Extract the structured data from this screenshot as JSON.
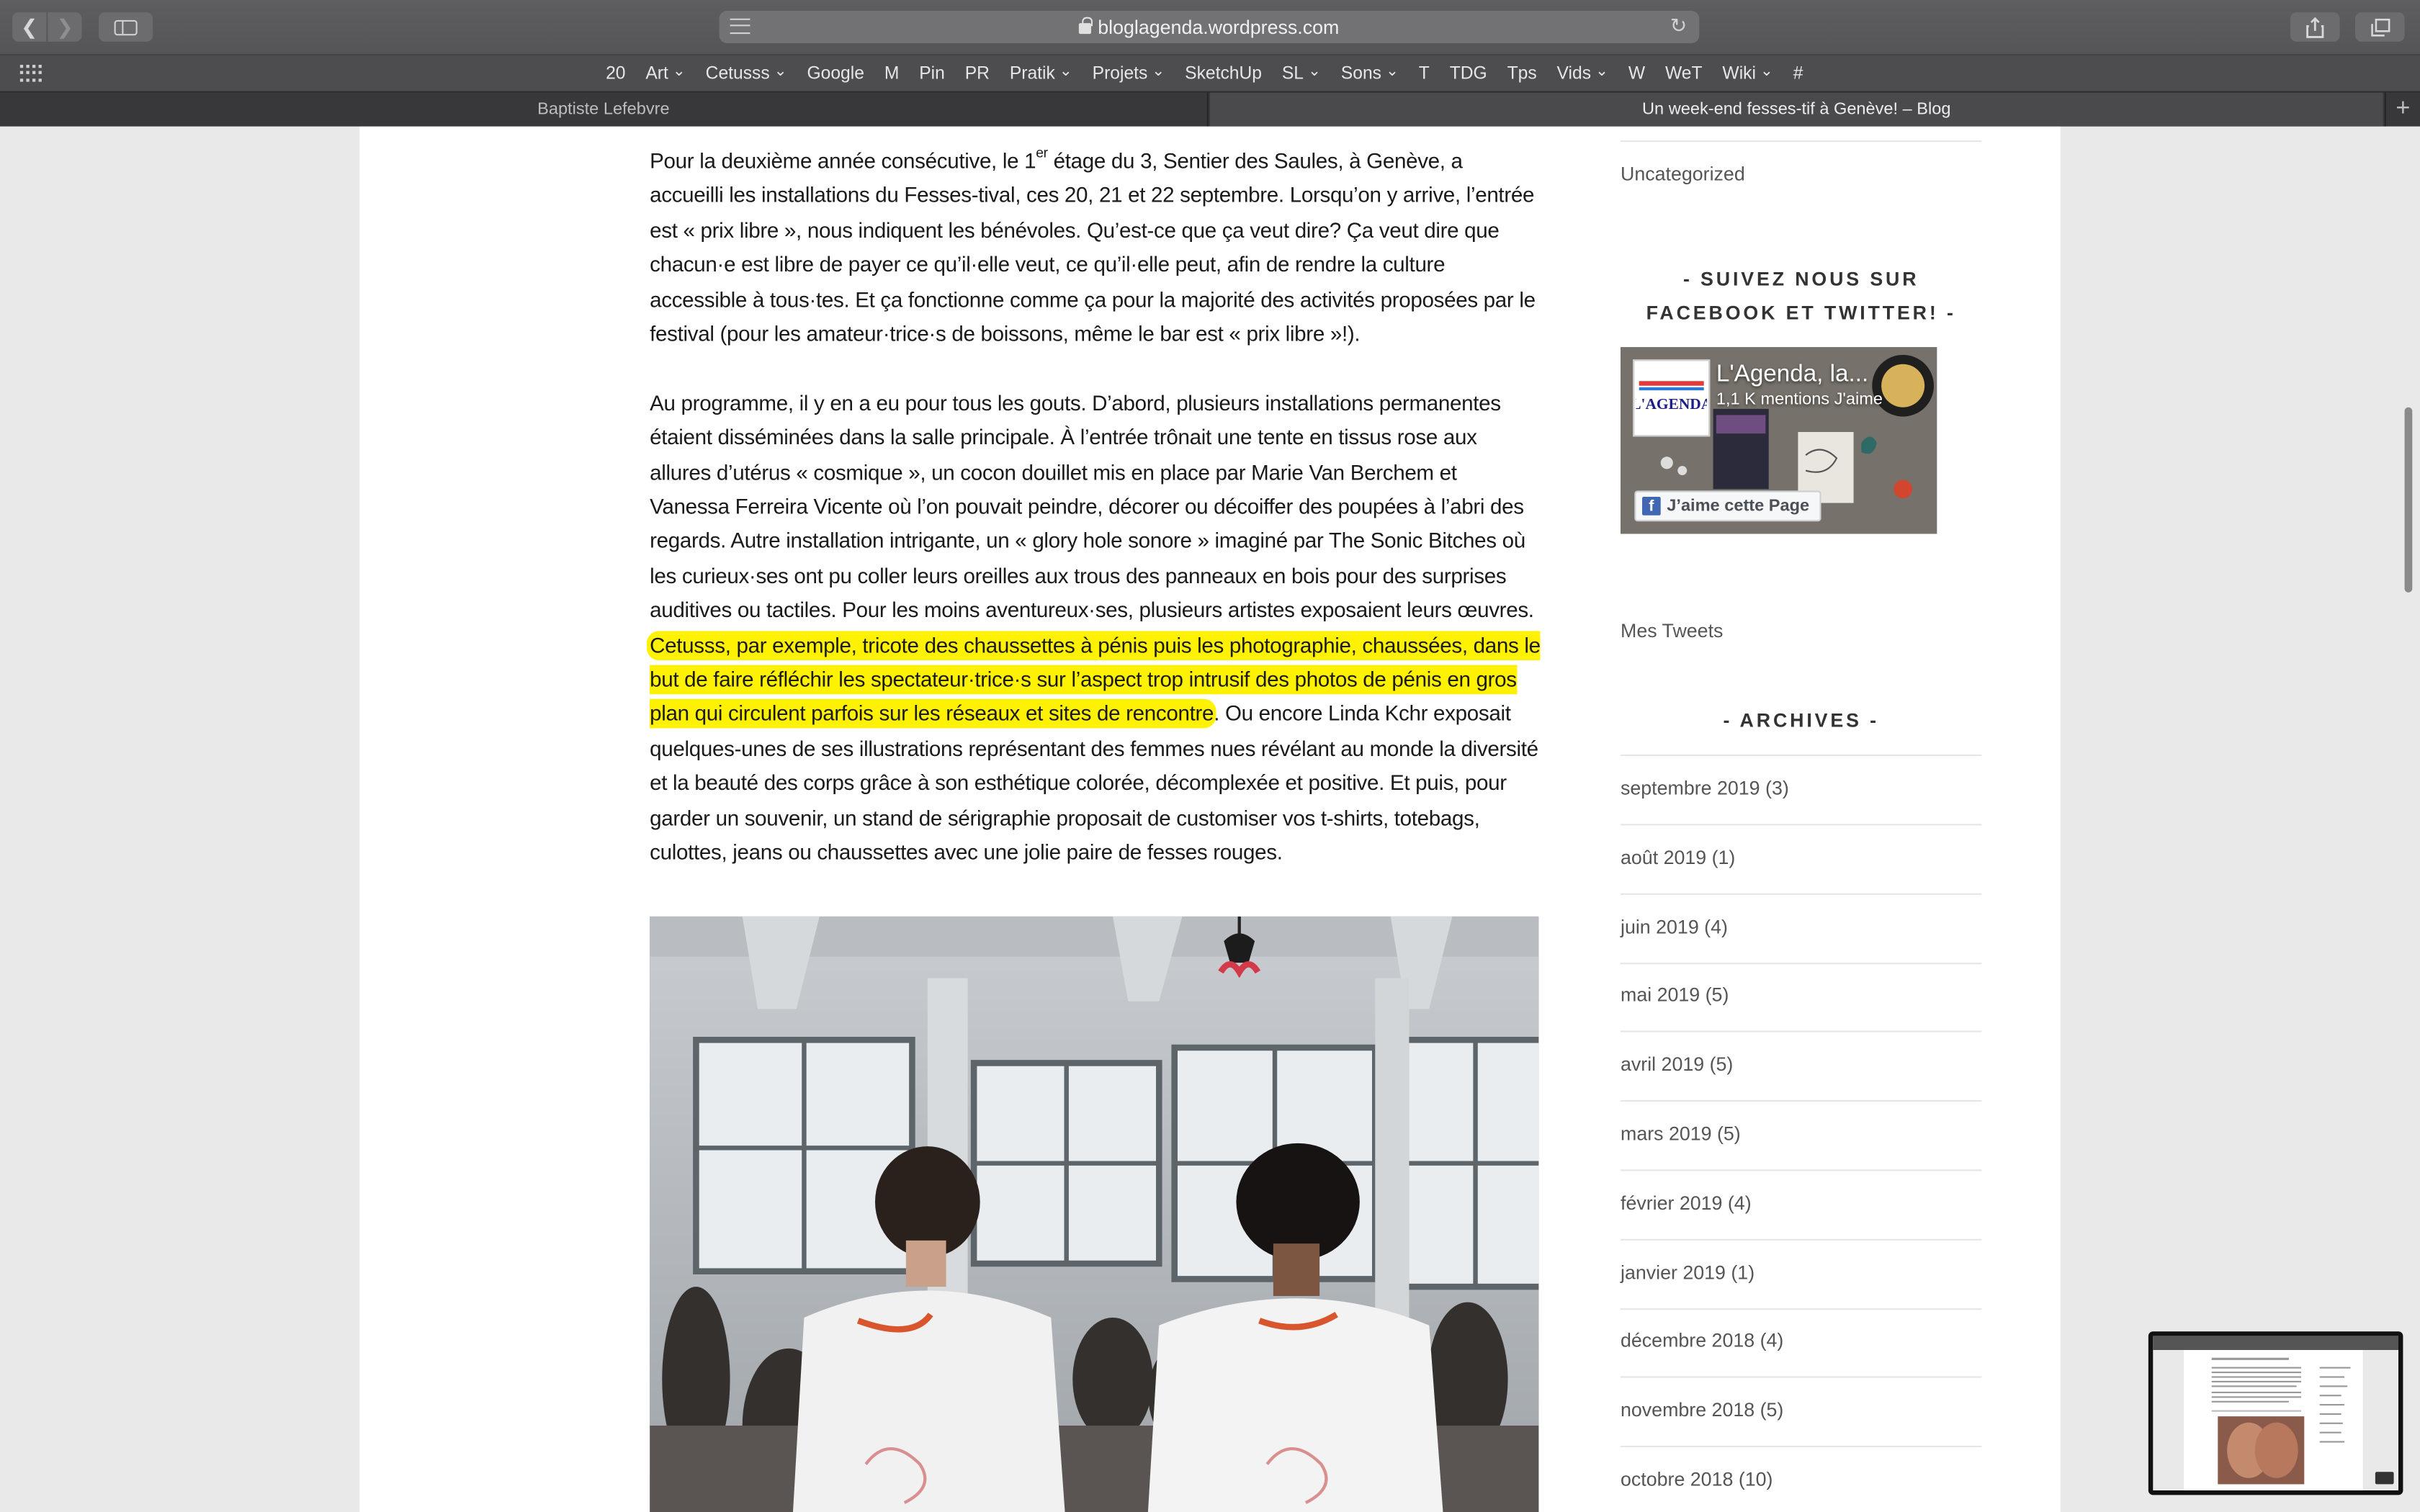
{
  "browser": {
    "url": "bloglagenda.wordpress.com",
    "favorites": [
      "20",
      "Art",
      "Cetusss",
      "Google",
      "M",
      "Pin",
      "PR",
      "Pratik",
      "Projets",
      "SketchUp",
      "SL",
      "Sons",
      "T",
      "TDG",
      "Tps",
      "Vids",
      "W",
      "WeT",
      "Wiki",
      "#"
    ],
    "favorites_with_menu": [
      "Art",
      "Cetusss",
      "Pratik",
      "Projets",
      "SL",
      "Sons",
      "Vids",
      "Wiki"
    ],
    "tabs": [
      {
        "title": "Baptiste Lefebvre",
        "active": false
      },
      {
        "title": "Un week-end fesses-tif à Genève! – Blog",
        "active": true
      }
    ],
    "icons": {
      "back": "chevron-left-icon",
      "forward": "chevron-right-icon",
      "sidebar": "sidebar-icon",
      "reader": "reader-icon",
      "lock": "lock-icon",
      "reload": "reload-icon",
      "share": "share-icon",
      "tabs": "tabs-icon",
      "favorites_grid": "grid-icon",
      "new_tab": "plus-icon"
    }
  },
  "article": {
    "p1_a": "Pour la deuxième année consécutive, le 1",
    "p1_sup": "er",
    "p1_b": " étage du 3, Sentier des Saules, à Genève, a accueilli les installations du Fesses-tival, ces 20, 21 et 22 septembre. Lorsqu’on y arrive, l’entrée est « prix libre », nous indiquent les bénévoles. Qu’est-ce que ça veut dire? Ça veut dire que chacun·e est libre de payer ce qu’il·elle veut, ce qu’il·elle peut, afin de rendre la culture accessible à tous·tes. Et ça fonctionne comme ça pour la majorité des activités proposées par le festival (pour les amateur·trice·s de boissons, même le bar est « prix libre »!).",
    "p2_a": "Au programme, il y en a eu pour tous les gouts. D’abord, plusieurs installations permanentes étaient disséminées dans la salle principale. À l’entrée trônait une tente en tissus rose aux allures d’utérus « cosmique », un cocon douillet mis en place par Marie Van Berchem et Vanessa Ferreira Vicente où l’on pouvait peindre, décorer ou décoiffer des poupées à l’abri des regards. Autre installation intrigante, un « glory hole sonore » imaginé par The Sonic Bitches où les curieux·ses ont pu coller leurs oreilles aux trous des panneaux en bois pour des surprises auditives ou tactiles. Pour les moins aventureux·ses, plusieurs artistes exposaient leurs œuvres. ",
    "p2_highlight": "Cetusss, par exemple, tricote des chaussettes à pénis puis les photographie, chaussées, dans le but de faire réfléchir les spectateur·trice·s sur l’aspect trop intrusif des photos de pénis en gros plan qui circulent parfois sur les réseaux et sites de rencontre",
    "p2_b": ". Ou encore Linda Kchr exposait quelques-unes de ses illustrations représentant des femmes nues révélant au monde la diversité et la beauté des corps grâce à son esthétique colorée, décomplexée et positive. Et puis, pour garder un souvenir, un stand de sérigraphie proposait de customiser vos t-shirts, totebags, culottes, jeans ou chaussettes avec une jolie paire de fesses rouges.",
    "highlight_color": "#fff200"
  },
  "sidebar": {
    "category": "Uncategorized",
    "follow_title": "- SUIVEZ NOUS SUR FACEBOOK ET TWITTER! -",
    "facebook": {
      "page_name": "L'Agenda, la...",
      "likes": "1,1 K mentions J'aime",
      "like_button": "J’aime cette Page",
      "logo_text": "L'AGENDA"
    },
    "tweets": "Mes Tweets",
    "archives_title": "- ARCHIVES -",
    "archives": [
      "septembre 2019 (3)",
      "août 2019 (1)",
      "juin 2019 (4)",
      "mai 2019 (5)",
      "avril 2019 (5)",
      "mars 2019 (5)",
      "février 2019 (4)",
      "janvier 2019 (1)",
      "décembre 2018 (4)",
      "novembre 2018 (5)",
      "octobre 2018 (10)"
    ]
  }
}
